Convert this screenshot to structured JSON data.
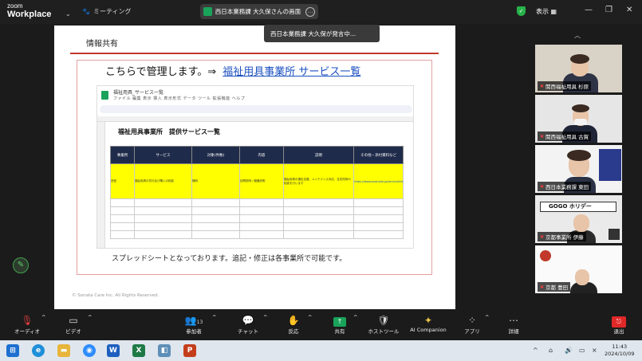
{
  "app": {
    "brand_line1": "zoom",
    "brand_line2": "Workplace",
    "meeting_label": "ミーティング"
  },
  "share_pill": {
    "text": "西日本業務課 大久保さんの画面"
  },
  "tooltip": {
    "text": "西日本業務課 大久保が発言中..."
  },
  "topbar_right": {
    "view_label": "表示"
  },
  "slide": {
    "title": "情報共有",
    "headline": "こちらで管理します。⇒",
    "headline_link": "福祉用具事業所 サービス一覧",
    "caption": "スプレッドシートとなっております。追記・修正は各事業所で可能です。",
    "footer": "© Sonata Care Inc. All Rights Reserved."
  },
  "sheet": {
    "filename": "福祉用具_サービス一覧",
    "menu": "ファイル 編集 表示 挿入 表示形式 データ ツール 拡張機能 ヘルプ",
    "title": "福祉用具事業所　提供サービス一覧",
    "headers": [
      "事業所",
      "サービス",
      "対象(件数)",
      "内容",
      "説明",
      "その他・添付資料など"
    ],
    "row": {
      "office": "西宮",
      "service": "福祉用具の貸与及び購入の相談",
      "target": "随時",
      "content": "訪問説明 / 機器説明",
      "description": "福祉用具の選定支援、メンテナンス対応、住宅改修の相談を行います",
      "link": "https://www.example.jp/service/list"
    }
  },
  "participants": [
    {
      "name": "関西福祉用具 杉原"
    },
    {
      "name": "関西福祉用具 古賀"
    },
    {
      "name": "西日本業務課 東田"
    },
    {
      "name": "京都事業所 伊藤"
    },
    {
      "name": ""
    },
    {
      "name": "京都 豊田"
    }
  ],
  "toolbar": {
    "audio": "オーディオ",
    "video": "ビデオ",
    "participants": "参加者",
    "participants_count": "13",
    "chat": "チャット",
    "react": "反応",
    "share": "共有",
    "host_tools": "ホストツール",
    "ai": "AI Companion",
    "apps": "アプリ",
    "more": "詳細",
    "leave": "退出"
  },
  "clock": {
    "time": "11:43",
    "date": "2024/10/09"
  },
  "colors": {
    "accent_green": "#1aa35b",
    "leave_red": "#e02828",
    "sheet_header": "#1f2b4a",
    "highlight": "#ffff00"
  }
}
